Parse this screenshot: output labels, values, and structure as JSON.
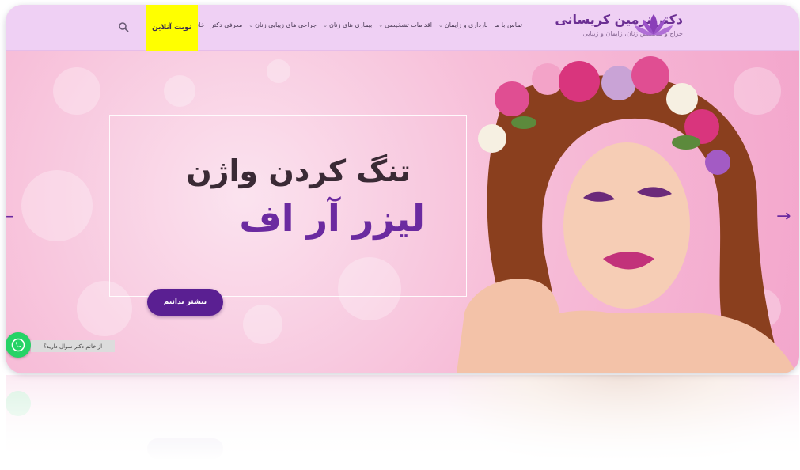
{
  "header": {
    "logo_title": "دکتر نرمین کریسانی",
    "logo_subtitle": "جراح و متخصص زنان، زایمان و زیبایی",
    "nav": [
      {
        "label": "خانه",
        "has_dropdown": false
      },
      {
        "label": "معرفی دکتر",
        "has_dropdown": false
      },
      {
        "label": "جراحی های زیبایی زنان",
        "has_dropdown": true
      },
      {
        "label": "بیماری های زنان",
        "has_dropdown": true
      },
      {
        "label": "اقدامات تشخیصی",
        "has_dropdown": true
      },
      {
        "label": "بارداری و زایمان",
        "has_dropdown": true
      },
      {
        "label": "تماس با ما",
        "has_dropdown": false
      }
    ],
    "cta_label": "نوبت آنلاین",
    "search_icon": "search-icon"
  },
  "hero": {
    "heading_line1": "تنگ کردن واژن",
    "heading_line2": "لیزر آر اف",
    "button_label": "بیشتر بدانیم",
    "prev_icon": "arrow-left-icon",
    "next_icon": "arrow-right-icon"
  },
  "chat": {
    "label": "از خانم دکتر سوال دارید؟",
    "icon": "whatsapp-icon"
  },
  "colors": {
    "header_bg": "#efd0f4",
    "cta_bg": "#ffff00",
    "brand_purple": "#6b2aa0",
    "button_purple": "#5a1f92",
    "whatsapp_green": "#25d366"
  }
}
